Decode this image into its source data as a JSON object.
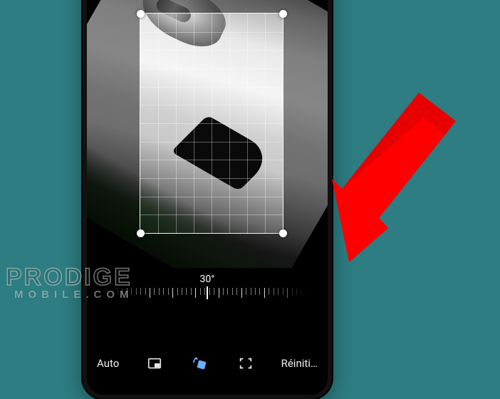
{
  "editor": {
    "angle_label": "30°",
    "toolbar": {
      "auto_label": "Auto",
      "reset_label": "Réiniti…"
    }
  },
  "watermark": {
    "line1": "PRODIGE",
    "line2": "MOBILE.COM"
  }
}
